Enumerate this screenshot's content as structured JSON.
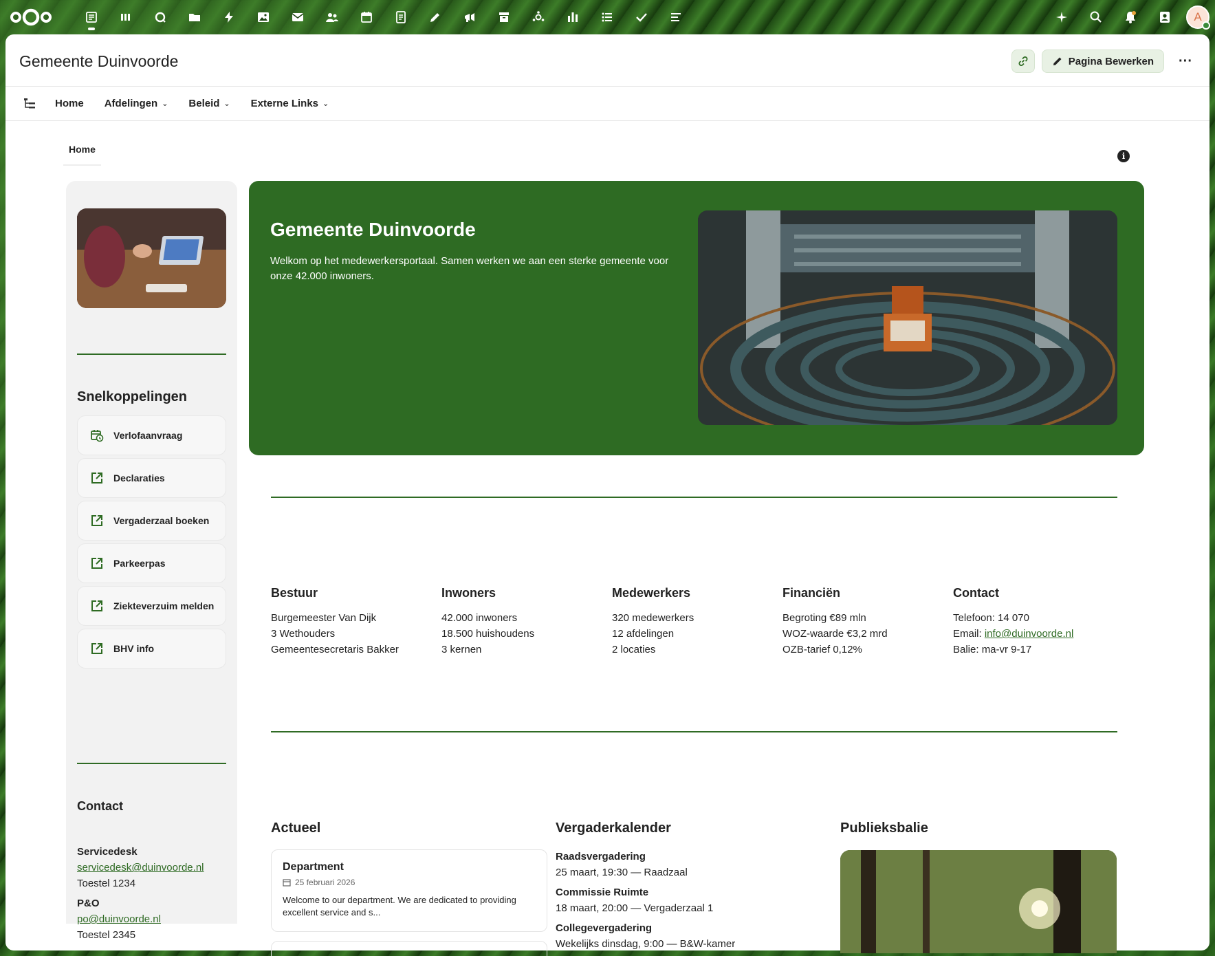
{
  "topbar": {
    "apps": [
      {
        "name": "dashboard-icon",
        "active": true
      },
      {
        "name": "deck-icon"
      },
      {
        "name": "search-app-icon"
      },
      {
        "name": "files-icon"
      },
      {
        "name": "activity-icon"
      },
      {
        "name": "photos-icon"
      },
      {
        "name": "mail-icon"
      },
      {
        "name": "contacts-icon"
      },
      {
        "name": "calendar-icon"
      },
      {
        "name": "notes-icon"
      },
      {
        "name": "text-edit-icon"
      },
      {
        "name": "announcements-icon"
      },
      {
        "name": "archive-icon"
      },
      {
        "name": "circles-icon"
      },
      {
        "name": "analytics-icon"
      },
      {
        "name": "list-icon"
      },
      {
        "name": "tasks-icon"
      },
      {
        "name": "forms-icon"
      }
    ],
    "avatar_initial": "A"
  },
  "header": {
    "title": "Gemeente Duinvoorde",
    "edit_label": "Pagina Bewerken",
    "more_label": "···"
  },
  "menu": {
    "items": [
      {
        "label": "Home",
        "has_dropdown": false
      },
      {
        "label": "Afdelingen",
        "has_dropdown": true
      },
      {
        "label": "Beleid",
        "has_dropdown": true
      },
      {
        "label": "Externe Links",
        "has_dropdown": true
      }
    ]
  },
  "breadcrumb": "Home",
  "info_glyph": "i",
  "sidebar": {
    "quick_links_heading": "Snelkoppelingen",
    "quick_links": [
      {
        "label": "Verlofaanvraag",
        "icon": "calendar-clock-icon"
      },
      {
        "label": "Declaraties",
        "icon": "open-in-new-icon"
      },
      {
        "label": "Vergaderzaal boeken",
        "icon": "open-in-new-icon"
      },
      {
        "label": "Parkeerpas",
        "icon": "open-in-new-icon"
      },
      {
        "label": "Ziekteverzuim melden",
        "icon": "open-in-new-icon"
      },
      {
        "label": "BHV info",
        "icon": "open-in-new-icon"
      }
    ],
    "contact_heading": "Contact",
    "contacts": [
      {
        "label": "Servicedesk",
        "email": "servicedesk@duinvoorde.nl",
        "phone": "Toestel 1234"
      },
      {
        "label": "P&O",
        "email": "po@duinvoorde.nl",
        "phone": "Toestel 2345"
      }
    ]
  },
  "hero": {
    "title": "Gemeente Duinvoorde",
    "text": "Welkom op het medewerkersportaal. Samen werken we aan een sterke gemeente voor onze 42.000 inwoners."
  },
  "stats": [
    {
      "title": "Bestuur",
      "lines": [
        "Burgemeester Van Dijk",
        "3 Wethouders",
        "Gemeentesecretaris Bakker"
      ]
    },
    {
      "title": "Inwoners",
      "lines": [
        "42.000 inwoners",
        "18.500 huishoudens",
        "3 kernen"
      ]
    },
    {
      "title": "Medewerkers",
      "lines": [
        "320 medewerkers",
        "12 afdelingen",
        "2 locaties"
      ]
    },
    {
      "title": "Financiën",
      "lines": [
        "Begroting €89 mln",
        "WOZ-waarde €3,2 mrd",
        "OZB-tarief 0,12%"
      ]
    },
    {
      "title": "Contact",
      "lines": [
        "Telefoon: 14 070",
        "Email: ",
        "Balie: ma-vr 9-17"
      ],
      "email": "info@duinvoorde.nl"
    }
  ],
  "actueel": {
    "title": "Actueel",
    "card": {
      "title": "Department",
      "date": "25 februari 2026",
      "excerpt": "Welcome to our department. We are dedicated to providing excellent service and s..."
    }
  },
  "vergaderkalender": {
    "title": "Vergaderkalender",
    "events": [
      {
        "title": "Raadsvergadering",
        "detail": "25 maart, 19:30 — Raadzaal"
      },
      {
        "title": "Commissie Ruimte",
        "detail": "18 maart, 20:00 — Vergaderzaal 1"
      },
      {
        "title": "Collegevergadering",
        "detail": "Wekelijks dinsdag, 9:00 — B&W-kamer"
      }
    ]
  },
  "publieksbalie": {
    "title": "Publieksbalie"
  },
  "colors": {
    "accent": "#2e6b23",
    "accent_light": "#e8f1e4"
  }
}
